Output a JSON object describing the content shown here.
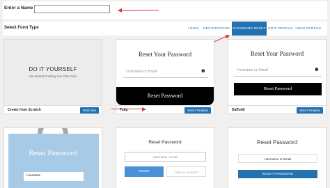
{
  "name_row": {
    "label": "Enter a Name",
    "value": ""
  },
  "toolbar": {
    "label": "Select Form Type",
    "tabs": [
      "LOGIN",
      "REGISTRATION",
      "PASSWORD RESET",
      "EDIT PROFILE",
      "USER PROFILE"
    ],
    "active_tab": "PASSWORD RESET"
  },
  "cards": [
    {
      "name": "Create from Scratch",
      "button": "Build New",
      "heading": "DO IT YOURSELF",
      "subheading": "Get Started Creating Your Own Form"
    },
    {
      "name": "Tulip",
      "button": "Select Template",
      "title": "Reset Your Password",
      "field_placeholder": "Username or Email",
      "submit": "Reset Password"
    },
    {
      "name": "Daffodil",
      "button": "Select Template",
      "title": "Reset Your Password",
      "field_placeholder": "Username or Email",
      "submit": "Reset Password"
    },
    {
      "title": "Reset Password",
      "field_value": "Username"
    },
    {
      "title": "Reset Password",
      "field_placeholder": "Username / Email",
      "submit": "RESET",
      "secondary": "Have an account?"
    },
    {
      "title": "Reset Password",
      "field_value": "Username or Email",
      "submit": "RESET PASSWORD"
    }
  ],
  "colors": {
    "accent": "#2271b1",
    "annotation": "#d63638",
    "muted_blue": "#a7cbe6"
  }
}
